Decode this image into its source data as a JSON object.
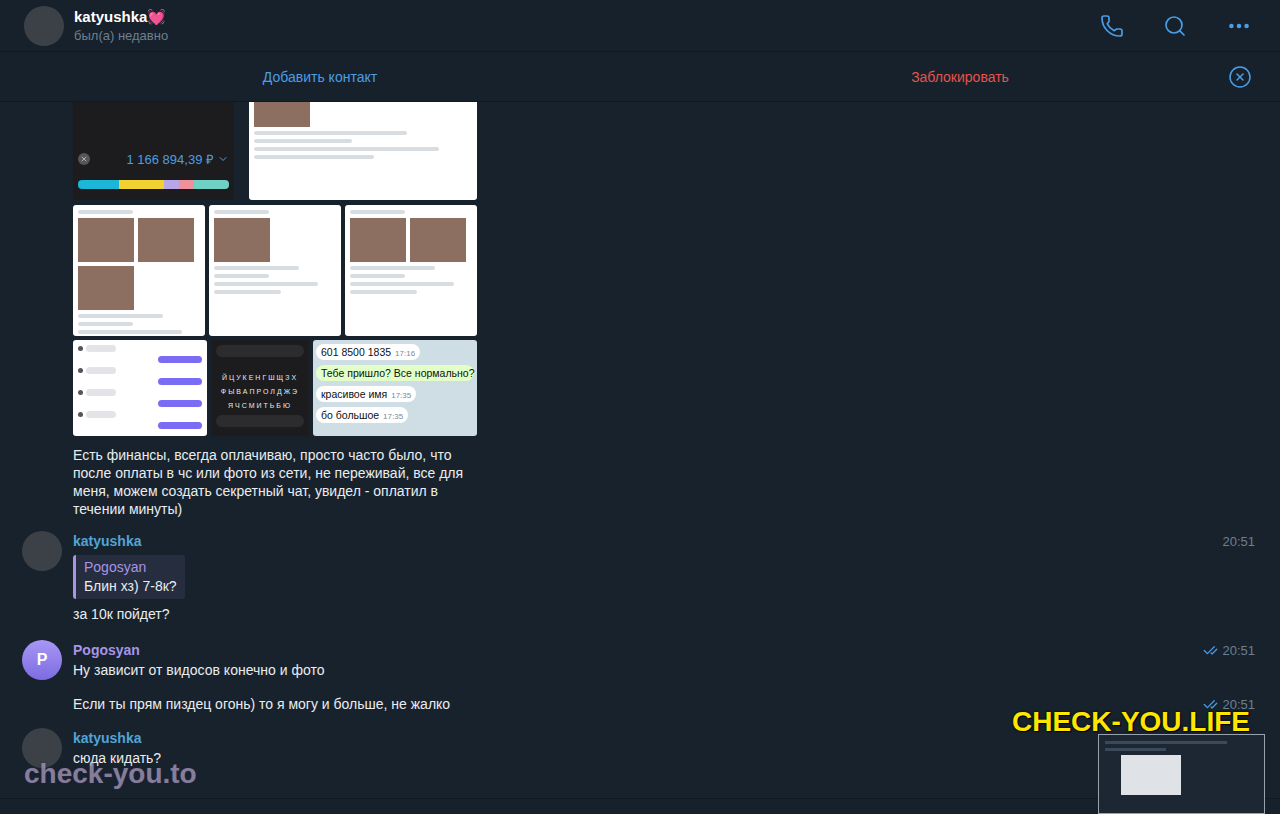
{
  "header": {
    "title": "katyushka💓",
    "status": "был(а) недавно"
  },
  "action_bar": {
    "buttons": [
      {
        "label": "Добавить контакт",
        "color": "#4a9ee6"
      },
      {
        "label": "Заблокировать",
        "color": "#e5534b"
      }
    ]
  },
  "album": {
    "rows": [
      [
        {
          "kind": "balance",
          "amount": "1 166 894,39 ₽",
          "segments": [
            {
              "color": "#1bb6d8",
              "level": 0.27
            },
            {
              "color": "#f2d230",
              "level": 0.3
            },
            {
              "color": "#b7a6e8",
              "level": 0.1
            },
            {
              "color": "#f0909a",
              "level": 0.1
            },
            {
              "color": "#6fd0c4",
              "level": 0.23
            }
          ]
        },
        {
          "kind": "photo-chat",
          "photos": 1
        }
      ],
      [
        {
          "kind": "photo-chat",
          "photos": 3
        },
        {
          "kind": "photo-chat",
          "photos": 1
        },
        {
          "kind": "photo-chat",
          "photos": 2
        }
      ],
      [
        {
          "kind": "bubble-chat",
          "bubbles": [
            "in",
            "out",
            "in",
            "out",
            "in",
            "out",
            "in",
            "out"
          ]
        },
        {
          "kind": "keyboard",
          "keys": [
            "ЙЦУКЕНГШЩЗХ",
            "ФЫВАПРОЛДЖЭ",
            "ЯЧСМИТЬБЮ"
          ]
        },
        {
          "kind": "telegram-chat",
          "lines": [
            {
              "text": "601 8500 1835",
              "time": "17:16",
              "side": "in"
            },
            {
              "text": "Тебе пришло? Все нормально?",
              "time": "",
              "side": "out"
            },
            {
              "text": "красивое имя",
              "time": "17:35",
              "side": "in"
            },
            {
              "text": "бо большое",
              "time": "17:35",
              "side": "in"
            }
          ]
        }
      ]
    ],
    "caption": "Есть финансы, всегда оплачиваю, просто часто было, что после оплаты в чс или фото из сети, не переживай, все для меня, можем создать секретный чат, увидел - оплатил в течении минуты)"
  },
  "groups": [
    {
      "author": "katyushka",
      "color": "#52a4d5",
      "avatar_letter": "",
      "time": "20:51",
      "read": false,
      "reply": {
        "author": "Pogosyan",
        "text": "Блин хз) 7-8к?"
      },
      "lines": [
        {
          "text": "за 10к пойдет?",
          "time": "",
          "read": false
        }
      ]
    },
    {
      "author": "Pogosyan",
      "color": "#a695e7",
      "avatar_letter": "P",
      "time": "20:51",
      "read": true,
      "reply": null,
      "lines": [
        {
          "text": "Ну зависит от видосов конечно и фото",
          "time": "",
          "read": false
        },
        {
          "text": "Если ты прям пиздец огонь) то я могу и больше, не жалко",
          "time": "20:51",
          "read": true
        }
      ]
    },
    {
      "author": "katyushka",
      "color": "#52a4d5",
      "avatar_letter": "",
      "time": "",
      "read": false,
      "reply": null,
      "lines": [
        {
          "text": "сюда кидать?",
          "time": "",
          "read": false
        }
      ]
    }
  ],
  "watermarks": {
    "main": "CHECK-YOU.LIFE",
    "corner": "check-you.to"
  }
}
